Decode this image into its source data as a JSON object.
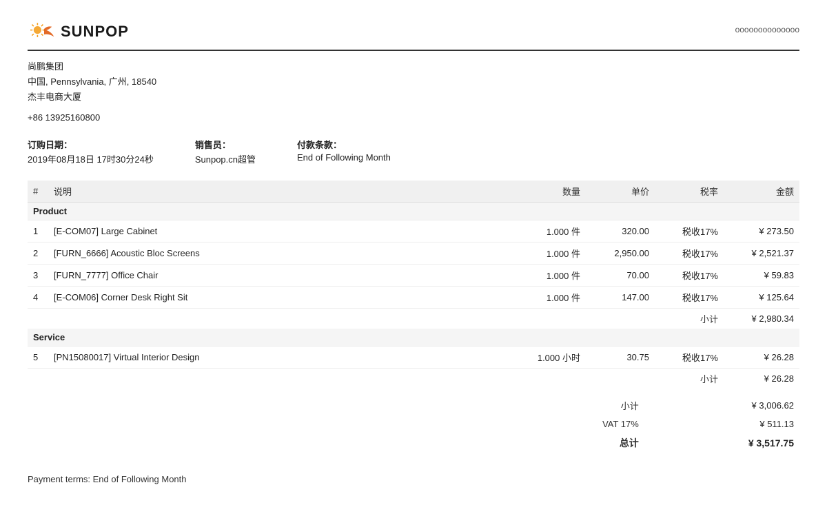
{
  "header": {
    "company_name": "SUNPOP",
    "account_number": "oooooooooooooo"
  },
  "company": {
    "name": "尚鹏集团",
    "address": "中国, Pennsylvania, 广州, 18540",
    "building": "杰丰电商大厦",
    "phone": "+86 13925160800"
  },
  "order": {
    "date_label": "订购日期：",
    "date_value": "2019年08月18日 17时30分24秒",
    "salesperson_label": "销售员：",
    "salesperson_value": "Sunpop.cn超管",
    "payment_label": "付款条款：",
    "payment_value": "End of Following Month"
  },
  "table": {
    "headers": {
      "num": "#",
      "description": "说明",
      "quantity": "数量",
      "unit_price": "单价",
      "tax_rate": "税率",
      "amount": "金额"
    },
    "product_section_label": "Product",
    "product_items": [
      {
        "num": "1",
        "description": "[E-COM07] Large Cabinet",
        "quantity": "1.000 件",
        "unit_price": "320.00",
        "tax_rate": "税收17%",
        "amount": "¥ 273.50"
      },
      {
        "num": "2",
        "description": "[FURN_6666] Acoustic Bloc Screens",
        "quantity": "1.000 件",
        "unit_price": "2,950.00",
        "tax_rate": "税收17%",
        "amount": "¥ 2,521.37"
      },
      {
        "num": "3",
        "description": "[FURN_7777] Office Chair",
        "quantity": "1.000 件",
        "unit_price": "70.00",
        "tax_rate": "税收17%",
        "amount": "¥ 59.83"
      },
      {
        "num": "4",
        "description": "[E-COM06] Corner Desk Right Sit",
        "quantity": "1.000 件",
        "unit_price": "147.00",
        "tax_rate": "税收17%",
        "amount": "¥ 125.64"
      }
    ],
    "product_subtotal_label": "小计",
    "product_subtotal_value": "¥ 2,980.34",
    "service_section_label": "Service",
    "service_items": [
      {
        "num": "5",
        "description": "[PN15080017] Virtual Interior Design",
        "quantity": "1.000 小时",
        "unit_price": "30.75",
        "tax_rate": "税收17%",
        "amount": "¥ 26.28"
      }
    ],
    "service_subtotal_label": "小计",
    "service_subtotal_value": "¥ 26.28"
  },
  "totals": {
    "subtotal_label": "小计",
    "subtotal_value": "¥ 3,006.62",
    "vat_label": "VAT 17%",
    "vat_value": "¥ 511.13",
    "grand_total_label": "总计",
    "grand_total_value": "¥ 3,517.75"
  },
  "footer": {
    "payment_terms": "Payment terms: End of Following Month"
  }
}
